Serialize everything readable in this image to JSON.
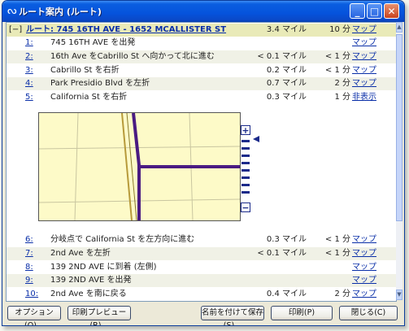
{
  "window": {
    "title": "ルート案内 (ルート)"
  },
  "titlebar_buttons": {
    "minimize": "_",
    "maximize": "□",
    "close": "✕"
  },
  "route_header": {
    "collapse": "[−]",
    "title": "ルート: 745 16TH AVE - 1652 MCALLISTER ST",
    "distance": "3.4 マイル",
    "time": "10 分",
    "link": "マップ"
  },
  "steps_top": [
    {
      "num": "1:",
      "text": "745 16TH AVE を出発",
      "distance": "",
      "time": "",
      "link": "マップ"
    },
    {
      "num": "2:",
      "text": "16th Ave をCabrillo St へ向かって北に進む",
      "distance": "< 0.1 マイル",
      "time": "< 1 分",
      "link": "マップ"
    },
    {
      "num": "3:",
      "text": "Cabrillo St を右折",
      "distance": "0.2 マイル",
      "time": "< 1 分",
      "link": "マップ"
    },
    {
      "num": "4:",
      "text": "Park Presidio Blvd を左折",
      "distance": "0.7 マイル",
      "time": "2 分",
      "link": "マップ"
    },
    {
      "num": "5:",
      "text": "California St を右折",
      "distance": "0.3 マイル",
      "time": "1 分",
      "link": "非表示"
    }
  ],
  "steps_bottom": [
    {
      "num": "6:",
      "text": "分岐点で California St を左方向に進む",
      "distance": "0.3 マイル",
      "time": "< 1 分",
      "link": "マップ"
    },
    {
      "num": "7:",
      "text": "2nd Ave を左折",
      "distance": "< 0.1 マイル",
      "time": "< 1 分",
      "link": "マップ"
    },
    {
      "num": "8:",
      "text": "139 2ND AVE に到着 (左側)",
      "distance": "",
      "time": "",
      "link": "マップ"
    },
    {
      "num": "9:",
      "text": "139 2ND AVE を出発",
      "distance": "",
      "time": "",
      "link": "マップ"
    },
    {
      "num": "10:",
      "text": "2nd Ave を南に戻る",
      "distance": "0.4 マイル",
      "time": "2 分",
      "link": "マップ"
    }
  ],
  "zoom": {
    "plus": "+",
    "minus": "−",
    "level_fraction": 0.05
  },
  "buttons": {
    "options": "オプション(O)...",
    "print_preview": "印刷プレビュー(R)...",
    "save_as": "名前を付けて保存(S)...",
    "print": "印刷(P)",
    "close": "閉じる(C)"
  },
  "scrollbar": {
    "up": "▲",
    "down": "▼"
  },
  "icons": {
    "title": "route-icon"
  }
}
